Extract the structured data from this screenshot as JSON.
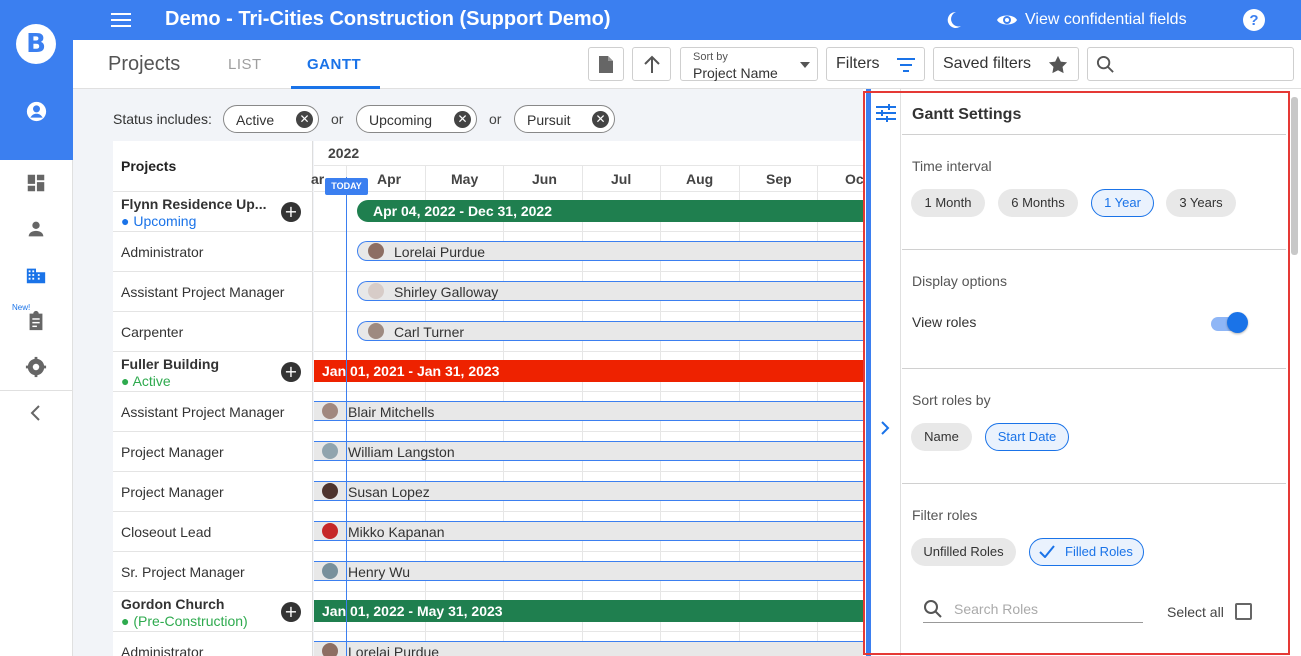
{
  "app": {
    "title": "Demo - Tri-Cities Construction (Support Demo)",
    "logo_letter": "B",
    "new_badge": "New!",
    "view_confidential_label": "View confidential fields"
  },
  "tabs": {
    "projects": "Projects",
    "list": "LIST",
    "gantt": "GANTT",
    "active": "GANTT"
  },
  "toolbar": {
    "sort_caption": "Sort by",
    "sort_value": "Project Name",
    "filters_label": "Filters",
    "saved_filters_label": "Saved filters",
    "search_placeholder": ""
  },
  "status_filter": {
    "label": "Status includes:",
    "connector": "or",
    "chips": [
      "Active",
      "Upcoming",
      "Pursuit"
    ]
  },
  "gantt": {
    "projects_header": "Projects",
    "year": "2022",
    "month_start_partial": "ar",
    "months": [
      "Apr",
      "May",
      "Jun",
      "Jul",
      "Aug",
      "Sep",
      "Oc"
    ],
    "today_label": "TODAY",
    "rows": [
      {
        "type": "project",
        "name": "Flynn Residence Up...",
        "status": "● Upcoming",
        "bar": "Apr 04, 2022 - Dec 31, 2022"
      },
      {
        "type": "role",
        "role": "Administrator",
        "person": "Lorelai Purdue"
      },
      {
        "type": "role",
        "role": "Assistant Project Manager",
        "person": "Shirley Galloway"
      },
      {
        "type": "role",
        "role": "Carpenter",
        "person": "Carl Turner"
      },
      {
        "type": "project",
        "name": "Fuller Building",
        "status": "● Active",
        "bar": "Jan 01, 2021 - Jan 31, 2023"
      },
      {
        "type": "role",
        "role": "Assistant Project Manager",
        "person": "Blair Mitchells"
      },
      {
        "type": "role",
        "role": "Project Manager",
        "person": "William Langston"
      },
      {
        "type": "role",
        "role": "Project Manager",
        "person": "Susan Lopez"
      },
      {
        "type": "role",
        "role": "Closeout Lead",
        "person": "Mikko Kapanan"
      },
      {
        "type": "role",
        "role": "Sr. Project Manager",
        "person": "Henry Wu"
      },
      {
        "type": "project",
        "name": "Gordon Church",
        "status": "● (Pre-Construction)",
        "bar": "Jan 01, 2022 - May 31, 2023"
      },
      {
        "type": "role",
        "role": "Administrator",
        "person": "Lorelai Purdue"
      }
    ]
  },
  "settings": {
    "title": "Gantt Settings",
    "time_interval": {
      "title": "Time interval",
      "options": [
        "1 Month",
        "6 Months",
        "1 Year",
        "3 Years"
      ],
      "selected": "1 Year"
    },
    "display_options": {
      "title": "Display options",
      "view_roles_label": "View roles",
      "view_roles_on": true
    },
    "sort_roles": {
      "title": "Sort roles by",
      "options": [
        "Name",
        "Start Date"
      ],
      "selected": "Start Date"
    },
    "filter_roles": {
      "title": "Filter roles",
      "options": [
        "Unfilled Roles",
        "Filled Roles"
      ],
      "selected": "Filled Roles",
      "search_placeholder": "Search Roles",
      "select_all_label": "Select all"
    }
  },
  "colors": {
    "brand": "#3b7ff0",
    "bar_green": "#1f7f4f",
    "bar_red": "#ee2200",
    "status_upcoming": "#1a73e8",
    "status_active": "#2eaa4e",
    "highlight": "#e53935"
  }
}
